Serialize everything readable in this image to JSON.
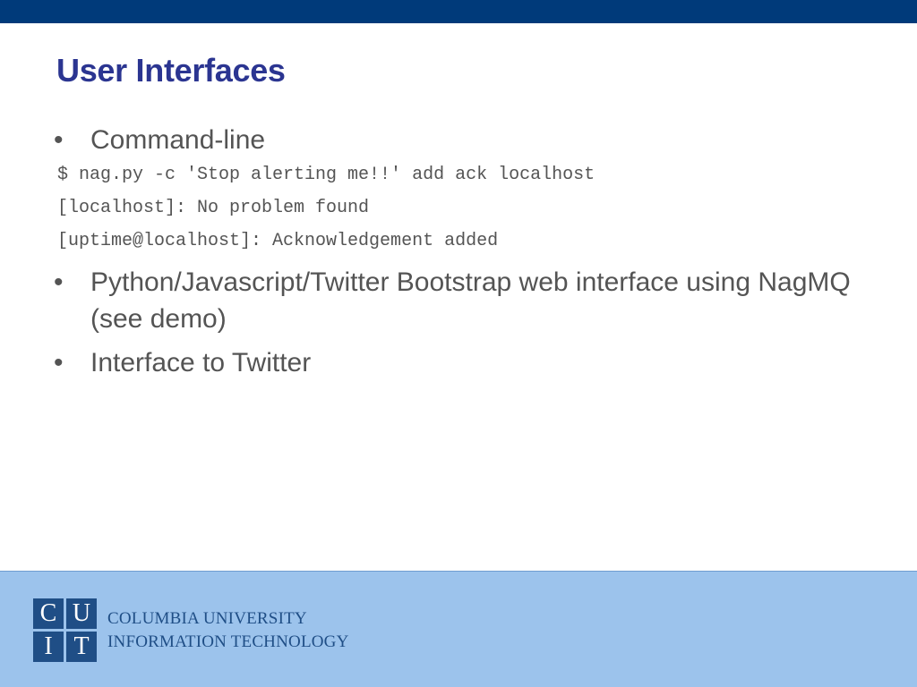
{
  "slide": {
    "title": "User Interfaces",
    "bullets": [
      {
        "text": "Command-line"
      },
      {
        "text": "Python/Javascript/Twitter Bootstrap web interface using NagMQ (see demo)"
      },
      {
        "text": "Interface to Twitter"
      }
    ],
    "bullet_symbol": "•",
    "code_lines": [
      "$ nag.py -c 'Stop alerting me!!' add ack localhost",
      "[localhost]: No problem found",
      "[uptime@localhost]: Acknowledgement added"
    ]
  },
  "footer": {
    "logo": {
      "letters": [
        "C",
        "U",
        "I",
        "T"
      ],
      "line1": "COLUMBIA UNIVERSITY",
      "line2": "INFORMATION TECHNOLOGY"
    }
  },
  "colors": {
    "top_bar": "#003a7a",
    "title": "#2b3591",
    "body_text": "#545454",
    "footer_bg": "#9cc3ec",
    "logo_blue": "#1f4e86"
  }
}
